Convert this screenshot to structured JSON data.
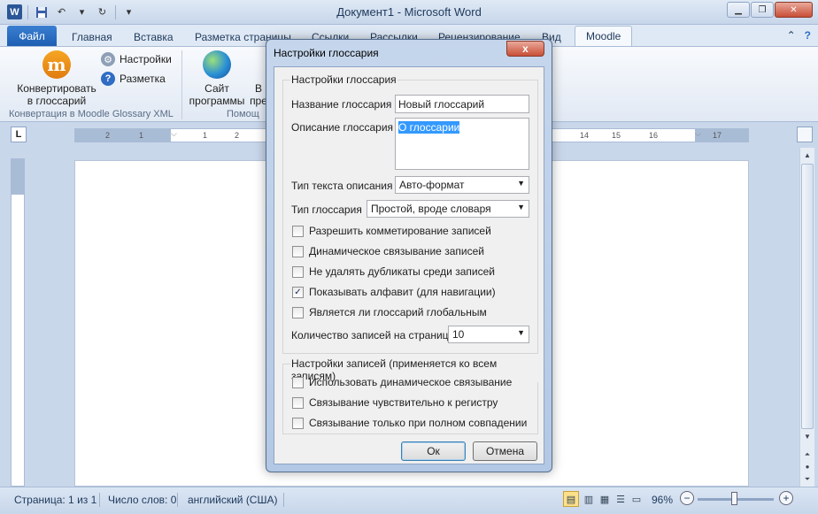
{
  "window": {
    "title": "Документ1 - Microsoft Word",
    "qat_app_icon": "W",
    "undo_arrow": "▾"
  },
  "tabs": [
    {
      "label": "Файл"
    },
    {
      "label": "Главная"
    },
    {
      "label": "Вставка"
    },
    {
      "label": "Разметка страницы"
    },
    {
      "label": "Ссылки"
    },
    {
      "label": "Рассылки"
    },
    {
      "label": "Рецензирование"
    },
    {
      "label": "Вид"
    },
    {
      "label": "Moodle"
    }
  ],
  "ribbon": {
    "convert_label_1": "Конвертировать",
    "convert_label_2": "в глоссарий",
    "settings_label": "Настройки",
    "markup_label": "Разметка",
    "group1_label": "Конвертация в Moodle Glossary XML",
    "site_label_1": "Сайт",
    "site_label_2": "программы",
    "partial_label_1": "В",
    "partial_label_2": "пре",
    "group2_label": "Помощ"
  },
  "ruler": {
    "tab_selector": "L",
    "labels_left": [
      "2",
      "1",
      "1",
      "2",
      "3",
      "4"
    ],
    "labels_right": [
      "12",
      "13",
      "14",
      "15",
      "16",
      "17"
    ]
  },
  "statusbar": {
    "page": "Страница: 1 из 1",
    "words": "Число слов: 0",
    "language": "английский (США)",
    "zoom": "96%",
    "zoom_value": 96
  },
  "dialog": {
    "title": "Настройки глоссария",
    "close": "x",
    "group1_legend": "Настройки глоссария",
    "name_label": "Название глоссария",
    "name_value": "Новый глоссарий",
    "desc_label": "Описание глоссария",
    "desc_value": "О глоссарии",
    "desc_type_label": "Тип текста описания",
    "desc_type_value": "Авто-формат",
    "glossary_type_label": "Тип глоссария",
    "glossary_type_value": "Простой, вроде словаря",
    "checkboxes": [
      {
        "label": "Разрешить комметирование записей",
        "checked": false
      },
      {
        "label": "Динамическое связывание записей",
        "checked": false
      },
      {
        "label": "Не удалять дубликаты среди записей",
        "checked": false
      },
      {
        "label": "Показывать алфавит (для навигации)",
        "checked": true
      },
      {
        "label": "Является ли глоссарий глобальным",
        "checked": false
      }
    ],
    "per_page_label": "Количество записей на страницу",
    "per_page_value": "10",
    "group2_legend": "Настройки записей (применяется ко всем записям)",
    "entry_checkboxes": [
      {
        "label": "Использовать динамическое связывание",
        "checked": false
      },
      {
        "label": "Связывание чувствительно к регистру",
        "checked": false
      },
      {
        "label": "Связывание только при полном совпадении",
        "checked": false
      }
    ],
    "ok": "Ок",
    "cancel": "Отмена"
  },
  "colors": {
    "file_tab": "#2b6cc4",
    "dialog_frame": "#b3c8e4",
    "selection": "#3399ff"
  }
}
